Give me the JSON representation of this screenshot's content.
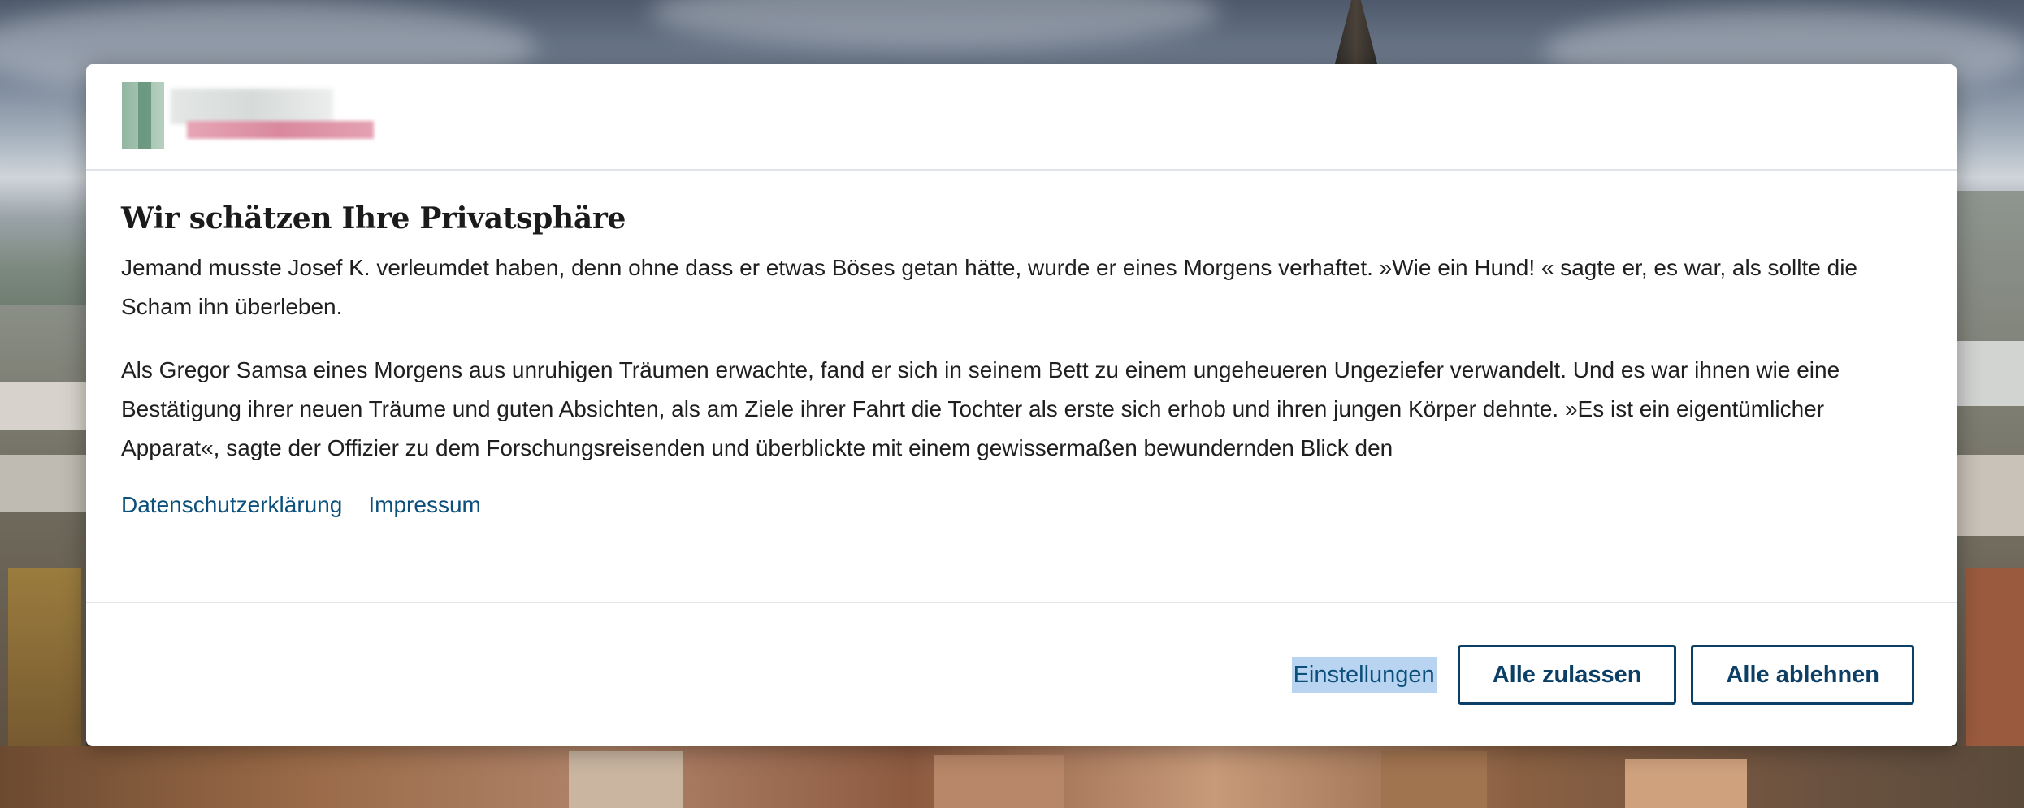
{
  "dialog": {
    "title": "Wir schätzen Ihre Privatsphäre",
    "paragraphs": [
      "Jemand musste Josef K. verleumdet haben, denn ohne dass er etwas Böses getan hätte, wurde er eines Morgens verhaftet. »Wie ein Hund! « sagte er, es war, als sollte die Scham ihn überleben.",
      "Als Gregor Samsa eines Morgens aus unruhigen Träumen erwachte, fand er sich in seinem Bett zu einem ungeheueren Ungeziefer verwandelt. Und es war ihnen wie eine Bestätigung ihrer neuen Träume und guten Absichten, als am Ziele ihrer Fahrt die Tochter als erste sich erhob und ihren jungen Körper dehnte. »Es ist ein eigentümlicher Apparat«, sagte der Offizier zu dem Forschungsreisenden und überblickte mit einem gewissermaßen bewundernden Blick den"
    ],
    "links": {
      "privacy": "Datenschutzerklärung",
      "imprint": "Impressum"
    },
    "buttons": {
      "settings": "Einstellungen",
      "accept_all": "Alle zulassen",
      "reject_all": "Alle ablehnen"
    }
  },
  "colors": {
    "accent": "#0c3f66",
    "link": "#0b4f7a",
    "settings_highlight": "#b8d4f0"
  }
}
